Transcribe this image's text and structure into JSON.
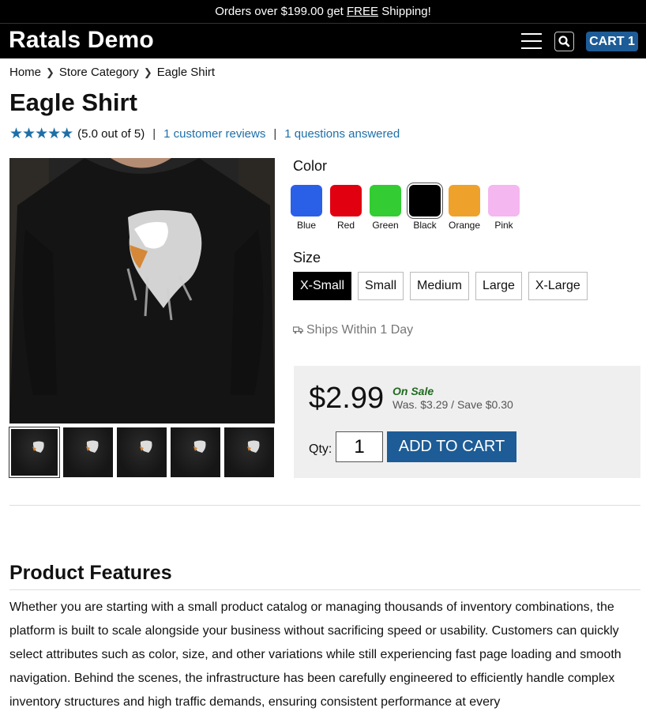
{
  "promo": {
    "before": "Orders over $199.00 get ",
    "free": "FREE",
    "after": " Shipping!"
  },
  "header": {
    "logo": "Ratals Demo",
    "cart_label": "CART 1"
  },
  "breadcrumb": [
    "Home",
    "Store Category",
    "Eagle Shirt"
  ],
  "product": {
    "title": "Eagle Shirt",
    "stars": "★★★★★",
    "rating_text": "(5.0 out of 5)",
    "reviews_link": "1 customer reviews",
    "questions_link": "1 questions answered",
    "color_label": "Color",
    "colors": [
      {
        "name": "Blue",
        "hex": "#2a60e8"
      },
      {
        "name": "Red",
        "hex": "#e00010"
      },
      {
        "name": "Green",
        "hex": "#33cc33"
      },
      {
        "name": "Black",
        "hex": "#000000"
      },
      {
        "name": "Orange",
        "hex": "#eea22b"
      },
      {
        "name": "Pink",
        "hex": "#f4b7f0"
      }
    ],
    "selected_color": "Black",
    "size_label": "Size",
    "sizes": [
      "X-Small",
      "Small",
      "Medium",
      "Large",
      "X-Large"
    ],
    "selected_size": "X-Small",
    "ships": "Ships Within 1 Day",
    "price": "$2.99",
    "on_sale": "On Sale",
    "was": "Was. $3.29 / Save $0.30",
    "qty_label": "Qty:",
    "qty_value": "1",
    "add_to_cart": "ADD TO CART"
  },
  "features": {
    "title": "Product Features",
    "text": "Whether you are starting with a small product catalog or managing thousands of inventory combinations, the platform is built to scale alongside your business without sacrificing speed or usability. Customers can quickly select attributes such as color, size, and other variations while still experiencing fast page loading and smooth navigation. Behind the scenes, the infrastructure has been carefully engineered to efficiently handle complex inventory structures and high traffic demands, ensuring consistent performance at every"
  },
  "colors": {
    "accent": "#1d5c96",
    "link": "#1d6fa8"
  },
  "icons": {
    "menu": "hamburger-icon",
    "search": "search-icon",
    "truck": "truck-icon",
    "chevron": "chevron-right-icon"
  }
}
